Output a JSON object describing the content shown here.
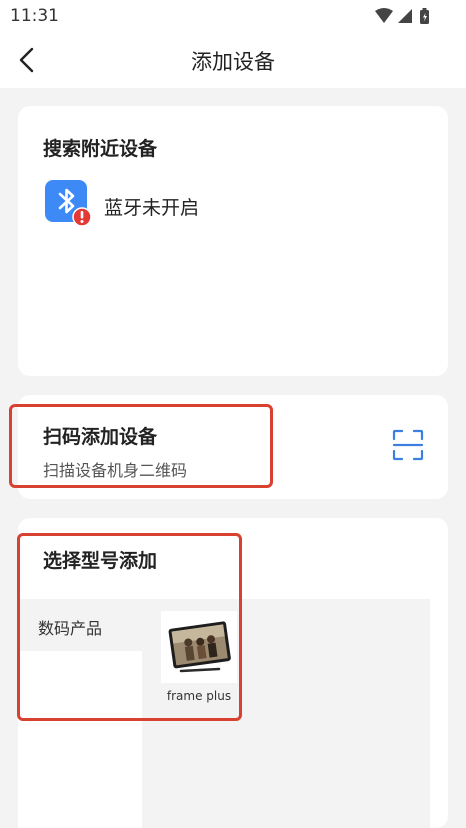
{
  "status_bar": {
    "time": "11:31"
  },
  "header": {
    "title": "添加设备"
  },
  "nearby": {
    "title": "搜索附近设备",
    "bluetooth_label": "蓝牙未开启"
  },
  "scan": {
    "title": "扫码添加设备",
    "subtitle": "扫描设备机身二维码"
  },
  "model": {
    "title": "选择型号添加",
    "categories": [
      "数码产品"
    ],
    "products": [
      {
        "name": "frame plus"
      }
    ]
  },
  "colors": {
    "accent": "#3b7fe0",
    "bluetooth_bg": "#3d8af7",
    "alert": "#e53935",
    "highlight": "#d8412f"
  }
}
